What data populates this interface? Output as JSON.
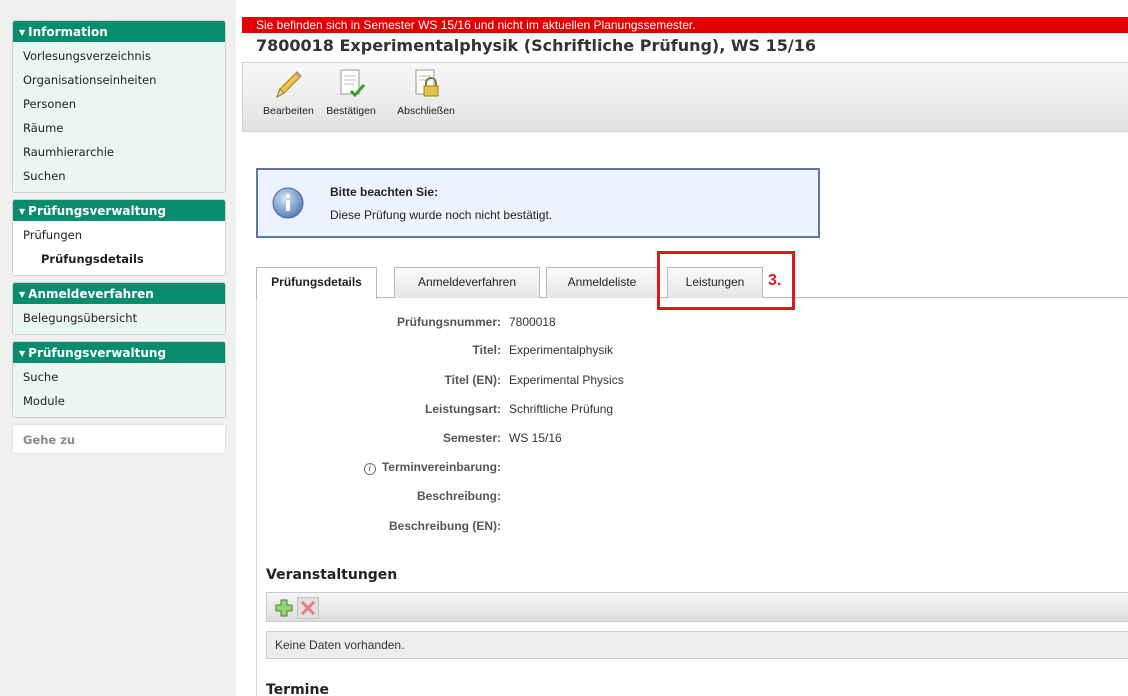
{
  "sidebar": {
    "sections": [
      {
        "title": "Information",
        "items": [
          "Vorlesungsverzeichnis",
          "Organisationseinheiten",
          "Personen",
          "Räume",
          "Raumhierarchie",
          "Suchen"
        ]
      },
      {
        "title": "Prüfungsverwaltung",
        "items": [
          "Prüfungen"
        ],
        "subitem": "Prüfungsdetails"
      },
      {
        "title": "Anmeldeverfahren",
        "items": [
          "Belegungsübersicht"
        ]
      },
      {
        "title": "Prüfungsverwaltung",
        "items": [
          "Suche",
          "Module"
        ]
      }
    ],
    "goto_label": "Gehe zu"
  },
  "warning": "Sie befinden sich in Semester WS 15/16 und nicht im aktuellen Planungssemester.",
  "page_title": "7800018 Experimentalphysik (Schriftliche Prüfung), WS 15/16",
  "toolbar": {
    "edit_label": "Bearbeiten",
    "confirm_label": "Bestätigen",
    "close_label": "Abschließen"
  },
  "notice": {
    "title": "Bitte beachten Sie:",
    "text": "Diese Prüfung wurde noch nicht bestätigt."
  },
  "tabs": [
    "Prüfungsdetails",
    "Anmeldeverfahren",
    "Anmeldeliste",
    "Leistungen"
  ],
  "active_tab": "Prüfungsdetails",
  "annotation": "3.",
  "details": [
    {
      "label": "Prüfungsnummer:",
      "value": "7800018"
    },
    {
      "label": "Titel:",
      "value": "Experimentalphysik"
    },
    {
      "label": "Titel (EN):",
      "value": "Experimental Physics"
    },
    {
      "label": "Leistungsart:",
      "value": "Schriftliche Prüfung"
    },
    {
      "label": "Semester:",
      "value": "WS 15/16"
    },
    {
      "label": "Terminvereinbarung:",
      "value": ""
    },
    {
      "label": "Beschreibung:",
      "value": ""
    },
    {
      "label": "Beschreibung (EN):",
      "value": ""
    }
  ],
  "sections": {
    "courses_title": "Veranstaltungen",
    "empty_text": "Keine Daten vorhanden.",
    "dates_title": "Termine"
  },
  "colors": {
    "nav_header": "#0a8c6e",
    "warning": "#e30000",
    "highlight": "#e4161d",
    "notice_border": "#5d78a8"
  }
}
